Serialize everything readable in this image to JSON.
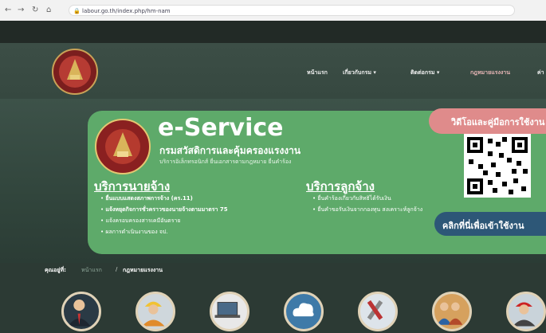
{
  "browser": {
    "url": "labour.go.th/index.php/hm-nam",
    "nav_icons": [
      "back-icon",
      "forward-icon",
      "reload-icon",
      "home-icon"
    ]
  },
  "header": {
    "menu": [
      {
        "label": "หน้าแรก"
      },
      {
        "label": "เกี่ยวกับกรม ▾"
      },
      {
        "label": "ติดต่อกรม ▾"
      },
      {
        "label": "กฎหมายแรงงาน"
      },
      {
        "label": "ค่า"
      }
    ]
  },
  "banner": {
    "title": "e-Service",
    "subtitle": "กรมสวัสดิการและคุ้มครองแรงงาน",
    "subtitle2": "บริการอิเล็กทรอนิกส์ ยื่นเอกสารตามกฎหมาย ยื่นคำร้อง",
    "video_label": "วิดีโอและคู่มือการใช้งาน",
    "cta_label": "คลิกที่นี่เพื่อเข้าใช้งาน",
    "cta_arrow": "❯",
    "employer": {
      "heading": "บริการนายจ้าง",
      "items": [
        "ยื่นแบบแสดงสภาพการจ้าง (คร.11)",
        "แจ้งหยุดกิจการชั่วคราวของนายจ้างตามมาตรา 75",
        "แจ้งครอบครองสารเคมีอันตราย",
        "ผลการดำเนินงานของ จป."
      ]
    },
    "employee": {
      "heading": "บริการลูกจ้าง",
      "items": [
        "ยื่นคำร้องเกี่ยวกับสิทธิได้รับเงิน",
        "ยื่นคำขอรับเงินจากกองทุน สงเคราะห์ลูกจ้าง"
      ]
    }
  },
  "breadcrumb": {
    "label": "คุณอยู่ที่:",
    "home": "หน้าแรก",
    "sep": "/",
    "current": "กฎหมายแรงงาน"
  },
  "icons": [
    "businessman-icon",
    "worker-helmet-icon",
    "laptop-icon",
    "cloud-icon",
    "tools-icon",
    "workers-icon",
    "firefighter-icon"
  ],
  "colors": {
    "banner": "#5eaa6a",
    "pill": "#df8b8b",
    "cta": "#2d5777",
    "icon_ring": "#e0d2b7"
  }
}
